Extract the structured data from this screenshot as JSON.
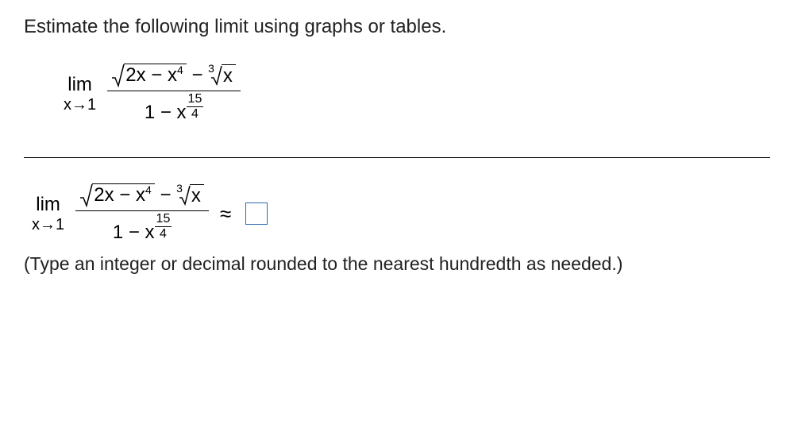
{
  "instruction": "Estimate the following limit using graphs or tables.",
  "limit": {
    "lim_text": "lim",
    "approach_var": "x",
    "arrow": "→",
    "approach_val": "1",
    "numerator": {
      "sqrt_radicand_a": "2x",
      "sqrt_minus": "−",
      "sqrt_radicand_b": "x",
      "sqrt_exp": "4",
      "minus": "−",
      "cbrt_index": "3",
      "cbrt_radicand": "x"
    },
    "denominator": {
      "one": "1",
      "minus": "−",
      "x": "x",
      "exp_num": "15",
      "exp_den": "4"
    }
  },
  "approx_symbol": "≈",
  "hint": "(Type an integer or decimal rounded to the nearest hundredth as needed.)"
}
